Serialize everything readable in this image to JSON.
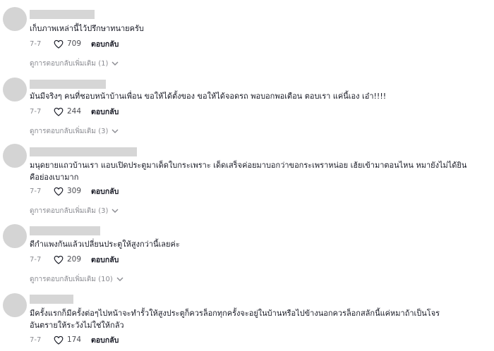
{
  "comments": [
    {
      "text": "เก็บภาพเหล่านี้ไว้ปรึกษาทนายครับ",
      "date": "7-7",
      "likes": "709",
      "reply_label": "ตอบกลับ",
      "more_replies": "ดูการตอบกลับเพิ่มเติม (1)"
    },
    {
      "text": "มันมีจริงๆ คนที่ชอบหน้าบ้านเพื่อน ขอให้ได้ตั้งของ ขอให้ได้จอดรถ พอบอกพอเตือน ตอบเรา แค่นี้เอง เอ๋า!!!!",
      "date": "7-7",
      "likes": "244",
      "reply_label": "ตอบกลับ",
      "more_replies": "ดูการตอบกลับเพิ่มเติม (3)"
    },
    {
      "text": "มนุดยายแถวบ้านเรา แอบเปิดประตูมาเด็ดใบกระเพราะ เด็ดเสร็จค่อยมาบอกว่าขอกระเพราหน่อย เฮ้ยเข้ามาตอนไหน หมายังไม่ได้ยิน คือย่องเบามาก",
      "date": "7-7",
      "likes": "309",
      "reply_label": "ตอบกลับ",
      "more_replies": "ดูการตอบกลับเพิ่มเติม (3)"
    },
    {
      "text": "ดีกำแพงกันแล้วเปลี่ยนประตูให้สูงกว่านี้เลยค่ะ",
      "date": "7-7",
      "likes": "209",
      "reply_label": "ตอบกลับ",
      "more_replies": "ดูการตอบกลับเพิ่มเติม (10)"
    },
    {
      "text": "มีครั้งแรกก็มีครั้งต่อๆไปหน้าจะทำรั้วให้สูงประตูก็ควรล็อกทุกครั้งจะอยู่ในบ้านหรือไปข้างนอกควรล็อกสลักนี้แค่หมาถ้าเป็นโจรอันตรายให้ระวังไม่ใช่ให้กลัว",
      "date": "7-7",
      "likes": "174",
      "reply_label": "ตอบกลับ"
    }
  ],
  "colors": {
    "text": "#161823",
    "muted": "#8a8b91",
    "avatar": "#d4d4d4",
    "redacted_name": "#d6d6d6"
  },
  "icons": {
    "like": "heart-outline-icon",
    "expand": "chevron-down-icon"
  }
}
